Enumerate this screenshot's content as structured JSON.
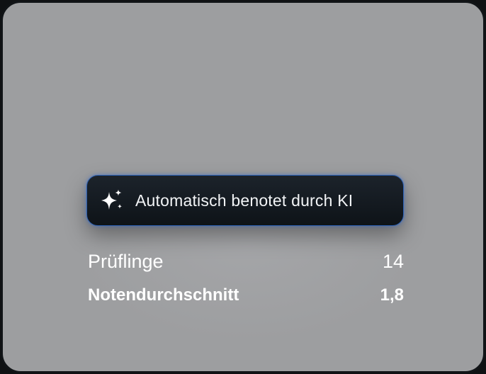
{
  "ai_badge": {
    "icon": "sparkle-icon",
    "label": "Automatisch benotet durch KI"
  },
  "stats": {
    "participants": {
      "label": "Prüflinge",
      "value": "14"
    },
    "average": {
      "label": "Notendurchschnitt",
      "value": "1,8"
    }
  },
  "colors": {
    "background": "#9d9ea0",
    "badge_bg": "#131920",
    "badge_border": "#2b5fb0",
    "text": "#ffffff"
  }
}
